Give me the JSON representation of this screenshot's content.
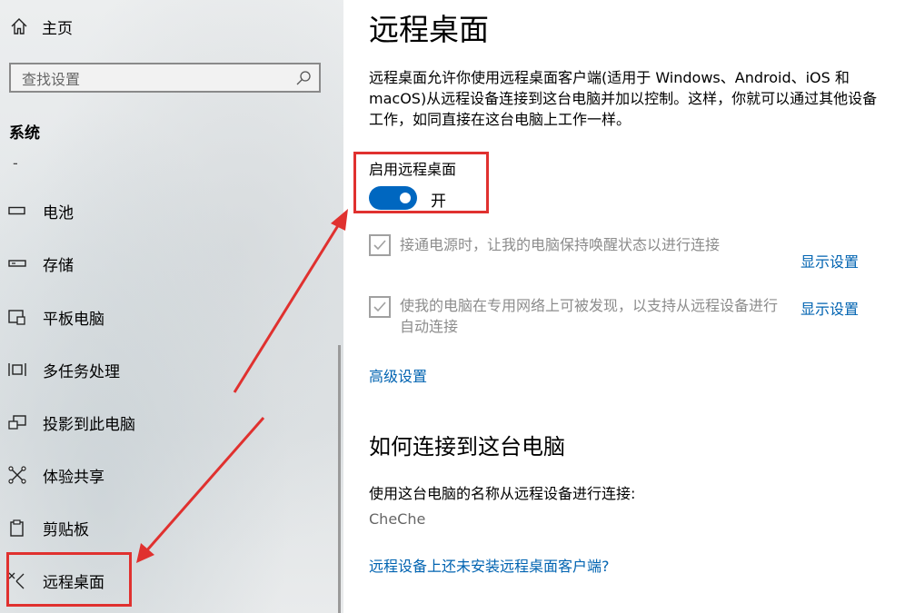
{
  "sidebar": {
    "home_label": "主页",
    "search_placeholder": "查找设置",
    "section_title": "系统",
    "dash": "-",
    "items": [
      {
        "label": "电池",
        "icon": "battery-icon"
      },
      {
        "label": "存储",
        "icon": "storage-icon"
      },
      {
        "label": "平板电脑",
        "icon": "tablet-icon"
      },
      {
        "label": "多任务处理",
        "icon": "multitasking-icon"
      },
      {
        "label": "投影到此电脑",
        "icon": "projecting-icon"
      },
      {
        "label": "体验共享",
        "icon": "shared-experiences-icon"
      },
      {
        "label": "剪贴板",
        "icon": "clipboard-icon"
      },
      {
        "label": "远程桌面",
        "icon": "remote-desktop-icon"
      }
    ]
  },
  "main": {
    "title": "远程桌面",
    "description": "远程桌面允许你使用远程桌面客户端(适用于 Windows、Android、iOS 和 macOS)从远程设备连接到这台电脑并加以控制。这样，你就可以通过其他设备工作，如同直接在这台电脑上工作一样。",
    "toggle_label": "启用远程桌面",
    "toggle_state": "开",
    "checkbox1": "接通电源时，让我的电脑保持唤醒状态以进行连接",
    "checkbox2": "使我的电脑在专用网络上可被发现，以支持从远程设备进行自动连接",
    "show_settings": "显示设置",
    "advanced_settings": "高级设置",
    "how_to_title": "如何连接到这台电脑",
    "how_to_info": "使用这台电脑的名称从远程设备进行连接:",
    "pc_name": "CheChe",
    "no_client_link": "远程设备上还未安装远程桌面客户端?"
  },
  "colors": {
    "accent": "#0067c0",
    "link": "#0063b1",
    "annotation": "#e0312f"
  }
}
